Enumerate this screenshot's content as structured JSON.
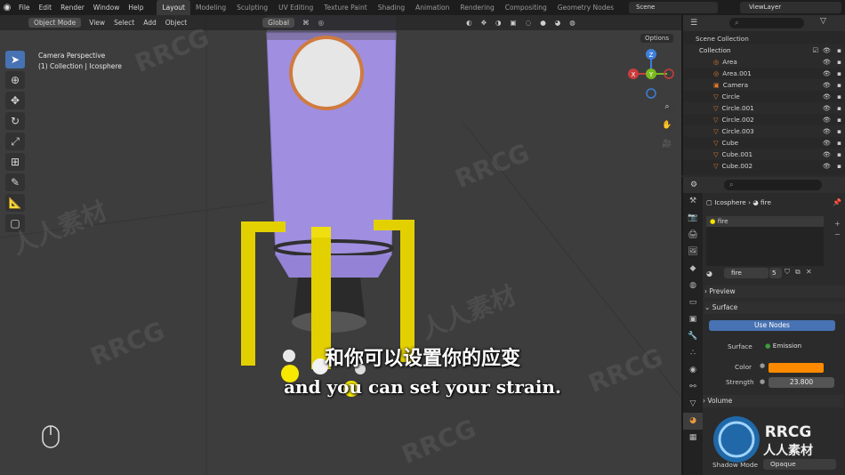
{
  "topbar": {
    "menus": [
      "File",
      "Edit",
      "Render",
      "Window",
      "Help"
    ],
    "workspaces": [
      "Layout",
      "Modeling",
      "Sculpting",
      "UV Editing",
      "Texture Paint",
      "Shading",
      "Animation",
      "Rendering",
      "Compositing",
      "Geometry Nodes"
    ],
    "scene": "Scene",
    "view_layer": "ViewLayer"
  },
  "viewport": {
    "header": {
      "mode": "Object Mode",
      "menus": [
        "View",
        "Select",
        "Add",
        "Object"
      ],
      "orientation": "Global",
      "options": "Options"
    },
    "info_line1": "Camera Perspective",
    "info_line2": "(1) Collection | Icosphere",
    "gizmo": {
      "z": "Z",
      "y": "Y",
      "x": "X"
    }
  },
  "subtitle": {
    "cn": "和你可以设置你的应变",
    "en": "and you can set your strain."
  },
  "watermark": {
    "text1": "RRCG",
    "text2": "人人素材"
  },
  "outliner": {
    "scene_collection": "Scene Collection",
    "collection": "Collection",
    "items": [
      "Area",
      "Area.001",
      "Camera",
      "Circle",
      "Circle.001",
      "Circle.002",
      "Circle.003",
      "Cube",
      "Cube.001",
      "Cube.002"
    ]
  },
  "properties": {
    "breadcrumb_object": "Icosphere",
    "breadcrumb_material": "fire",
    "slot": "fire",
    "material_name": "fire",
    "users": "5",
    "preview": "Preview",
    "surface": "Surface",
    "use_nodes": "Use Nodes",
    "surface_label": "Surface",
    "surface_value": "Emission",
    "color_label": "Color",
    "strength_label": "Strength",
    "strength_value": "23.800",
    "volume": "Volume",
    "shadow_mode_label": "Shadow Mode",
    "shadow_mode_value": "Opaque",
    "color_hex": "#ff8a00"
  },
  "logo": {
    "text1": "RRCG",
    "text2": "人人素材"
  }
}
